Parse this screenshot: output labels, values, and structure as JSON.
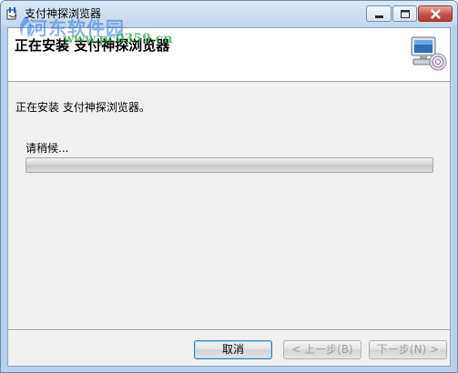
{
  "window": {
    "title": "支付神探浏览器",
    "icon": "installer-icon",
    "minimize_icon": "minimize-icon",
    "maximize_icon": "maximize-icon",
    "close_icon": "close-icon"
  },
  "banner": {
    "title": "正在安装 支付神探浏览器",
    "icon": "computer-cd-icon",
    "watermark_cn": "河东软件园",
    "watermark_url": "www.pc0359.cn"
  },
  "body": {
    "status_text": "正在安装 支付神探浏览器。",
    "progress_label": "请稍候...",
    "progress": 0.0
  },
  "buttons": {
    "cancel": "取消",
    "back": "< 上一步(B)",
    "next": "下一步(N) >"
  },
  "colors": {
    "frame": "#b9d1ea",
    "client": "#f0f0f0",
    "close_button": "#c75050"
  }
}
